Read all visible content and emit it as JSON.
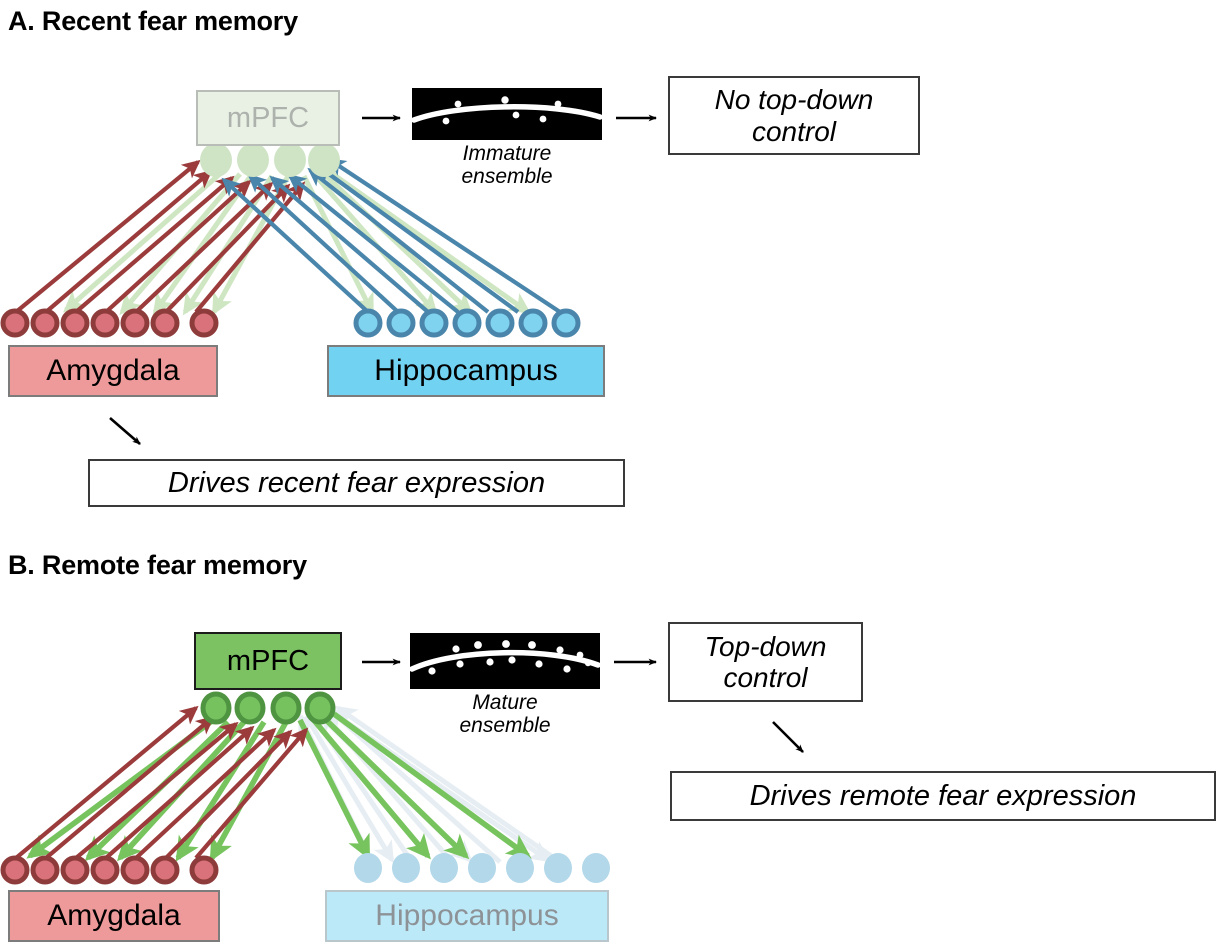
{
  "figure": {
    "panels": [
      {
        "id": "A",
        "title": "A. Recent fear memory",
        "mpfc_label": "mPFC",
        "mpfc_state": "faded",
        "ensemble_caption_line1": "Immature",
        "ensemble_caption_line2": "ensemble",
        "ensemble_spine_count": 6,
        "outcome_line1": "No top-down",
        "outcome_line2": "control",
        "drives_label": "Drives recent fear expression",
        "amygdala_label": "Amygdala",
        "hippocampus_label": "Hippocampus",
        "amygdala_state": "active",
        "hippocampus_state": "active",
        "amygdala_neuron_count": 7,
        "hippocampus_neuron_count": 7,
        "mpfc_neuron_count": 4,
        "mpfc_neuron_state": "faded"
      },
      {
        "id": "B",
        "title": "B. Remote fear memory",
        "mpfc_label": "mPFC",
        "mpfc_state": "active",
        "ensemble_caption_line1": "Mature",
        "ensemble_caption_line2": "ensemble",
        "ensemble_spine_count": 13,
        "outcome_line1": "Top-down",
        "outcome_line2": "control",
        "drives_label": "Drives remote fear expression",
        "amygdala_label": "Amygdala",
        "hippocampus_label": "Hippocampus",
        "amygdala_state": "active",
        "hippocampus_state": "faded",
        "amygdala_neuron_count": 7,
        "hippocampus_neuron_count": 7,
        "mpfc_neuron_count": 4,
        "mpfc_neuron_state": "active"
      }
    ]
  },
  "colors": {
    "amygdala_fill": "#ef9a9a",
    "amygdala_neuron_fill": "#d9727a",
    "amygdala_neuron_stroke": "#8e3b3b",
    "hippocampus_fill": "#72d2f2",
    "hippocampus_fill_faded": "#bce9f8",
    "hippocampus_neuron_fill": "#7fd3ef",
    "hippocampus_neuron_stroke": "#4a86ab",
    "hippocampus_neuron_faded": "#b3d8ea",
    "mpfc_fill_active": "#7cc262",
    "mpfc_fill_faded": "#e9f1e5",
    "mpfc_text_faded": "#adb2ad",
    "mpfc_neuron_active_fill": "#76c25e",
    "mpfc_neuron_active_stroke": "#4f9441",
    "mpfc_neuron_faded_fill": "#cfe4c5",
    "arrow_red": "#9b3b3b",
    "arrow_blue": "#4a86ab",
    "arrow_green_strong": "#77c45e",
    "arrow_green_pale": "#cfe6c2",
    "arrow_faded_gray": "#e7eef3",
    "box_border": "#7c7c7c",
    "callout_border": "#3a3a3a",
    "ensemble_bg": "#000000",
    "ensemble_fg": "#ffffff"
  }
}
